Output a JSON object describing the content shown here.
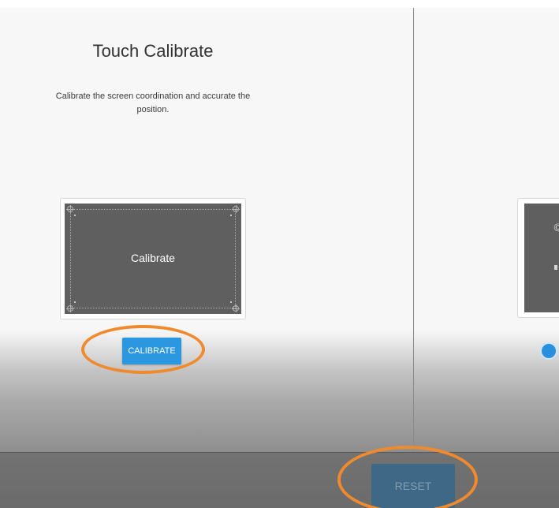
{
  "panel": {
    "title": "Touch Calibrate",
    "description": "Calibrate the screen coordination and accurate the position.",
    "preview_label": "Calibrate",
    "calibrate_label": "CALIBRATE"
  },
  "footer": {
    "reset_label": "RESET"
  },
  "right_panel": {
    "partial_glyph": "©"
  },
  "colors": {
    "button_blue": "#2a97e0",
    "highlight_orange": "#f08a2e",
    "preview_gray": "#5f5f5f",
    "reset_blue": "#3e6885"
  },
  "icons": [
    "crosshair-icon",
    "radio-selected-icon"
  ]
}
